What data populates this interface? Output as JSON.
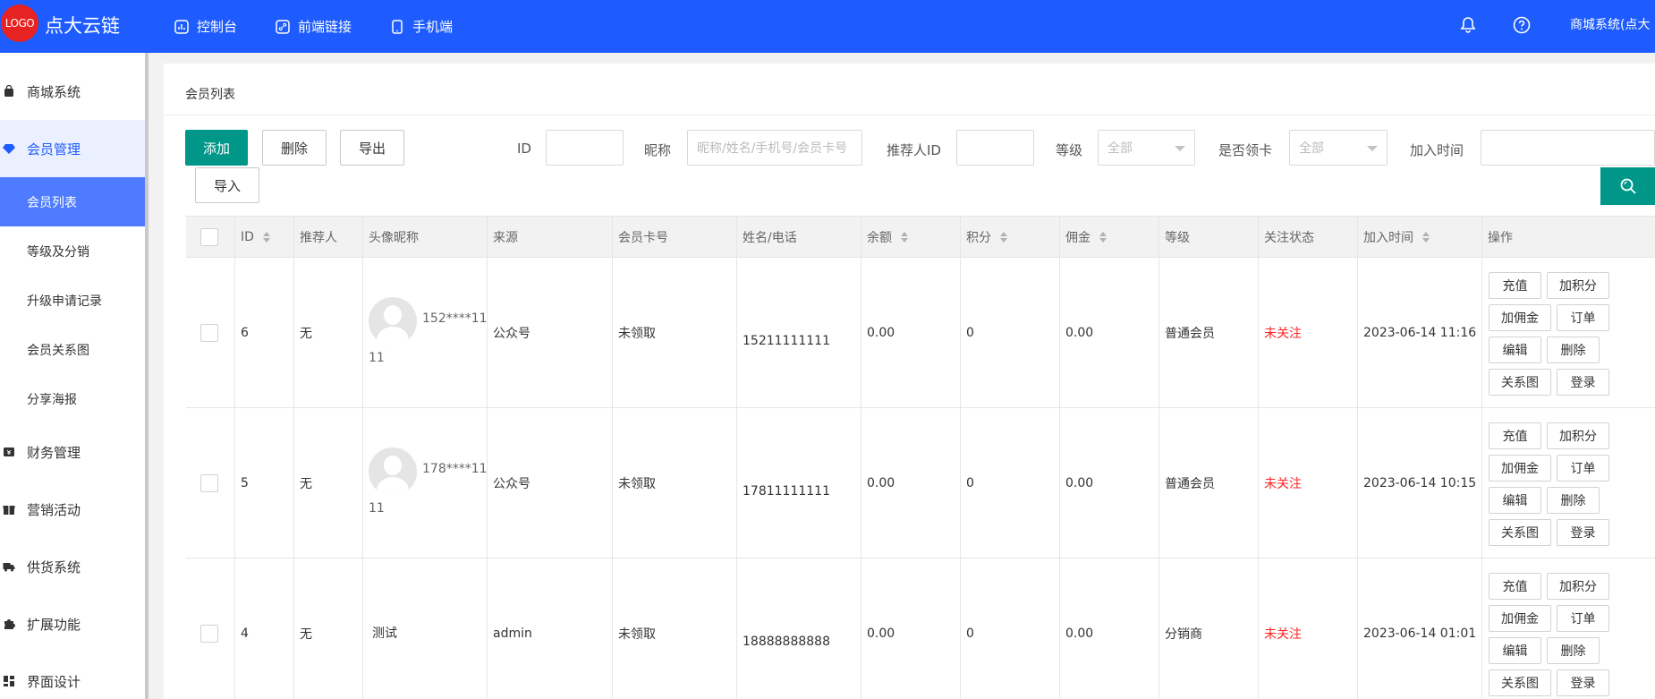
{
  "header": {
    "logo_text": "LOGO",
    "brand": "点大云链",
    "nav": [
      {
        "label": "控制台",
        "icon": "dashboard-icon"
      },
      {
        "label": "前端链接",
        "icon": "link-icon"
      },
      {
        "label": "手机端",
        "icon": "phone-icon"
      }
    ],
    "user": "商城系统(点大"
  },
  "sidebar": {
    "groups": [
      {
        "label": "商城系统",
        "icon": "bag-icon"
      },
      {
        "label": "会员管理",
        "icon": "diamond-icon"
      },
      {
        "label": "财务管理",
        "icon": "finance-icon"
      },
      {
        "label": "营销活动",
        "icon": "gift-icon"
      },
      {
        "label": "供货系统",
        "icon": "truck-icon"
      },
      {
        "label": "扩展功能",
        "icon": "puzzle-icon"
      },
      {
        "label": "界面设计",
        "icon": "layout-icon"
      }
    ],
    "member_subs": [
      "会员列表",
      "等级及分销",
      "升级申请记录",
      "会员关系图",
      "分享海报"
    ]
  },
  "page": {
    "title": "会员列表"
  },
  "toolbar": {
    "add": "添加",
    "delete": "删除",
    "export": "导出",
    "import": "导入"
  },
  "filters": {
    "id_label": "ID",
    "nickname_label": "昵称",
    "nickname_placeholder": "昵称/姓名/手机号/会员卡号",
    "referrer_label": "推荐人ID",
    "level_label": "等级",
    "level_value": "全部",
    "card_label": "是否领卡",
    "card_value": "全部",
    "join_label": "加入时间"
  },
  "table": {
    "headers": [
      "ID",
      "推荐人",
      "头像昵称",
      "来源",
      "会员卡号",
      "姓名/电话",
      "余额",
      "积分",
      "佣金",
      "等级",
      "关注状态",
      "加入时间",
      "操作"
    ],
    "rows": [
      {
        "id": "6",
        "referrer": "无",
        "nick_1": "152****11",
        "nick_2": "11",
        "has_avatar": true,
        "source": "公众号",
        "card": "未领取",
        "phone": "15211111111",
        "balance": "0.00",
        "points": "0",
        "commission": "0.00",
        "level": "普通会员",
        "follow": "未关注",
        "joined": "2023-06-14 11:16"
      },
      {
        "id": "5",
        "referrer": "无",
        "nick_1": "178****11",
        "nick_2": "11",
        "has_avatar": true,
        "source": "公众号",
        "card": "未领取",
        "phone": "17811111111",
        "balance": "0.00",
        "points": "0",
        "commission": "0.00",
        "level": "普通会员",
        "follow": "未关注",
        "joined": "2023-06-14 10:15"
      },
      {
        "id": "4",
        "referrer": "无",
        "nick_1": "测试",
        "nick_2": "",
        "has_avatar": false,
        "source": "admin",
        "card": "未领取",
        "phone": "18888888888",
        "balance": "0.00",
        "points": "0",
        "commission": "0.00",
        "level": "分销商",
        "follow": "未关注",
        "joined": "2023-06-14 01:01"
      }
    ],
    "ops": {
      "recharge": "充值",
      "add_points": "加积分",
      "add_commission": "加佣金",
      "orders": "订单",
      "edit": "编辑",
      "delete": "删除",
      "relation": "关系图",
      "login": "登录"
    }
  }
}
